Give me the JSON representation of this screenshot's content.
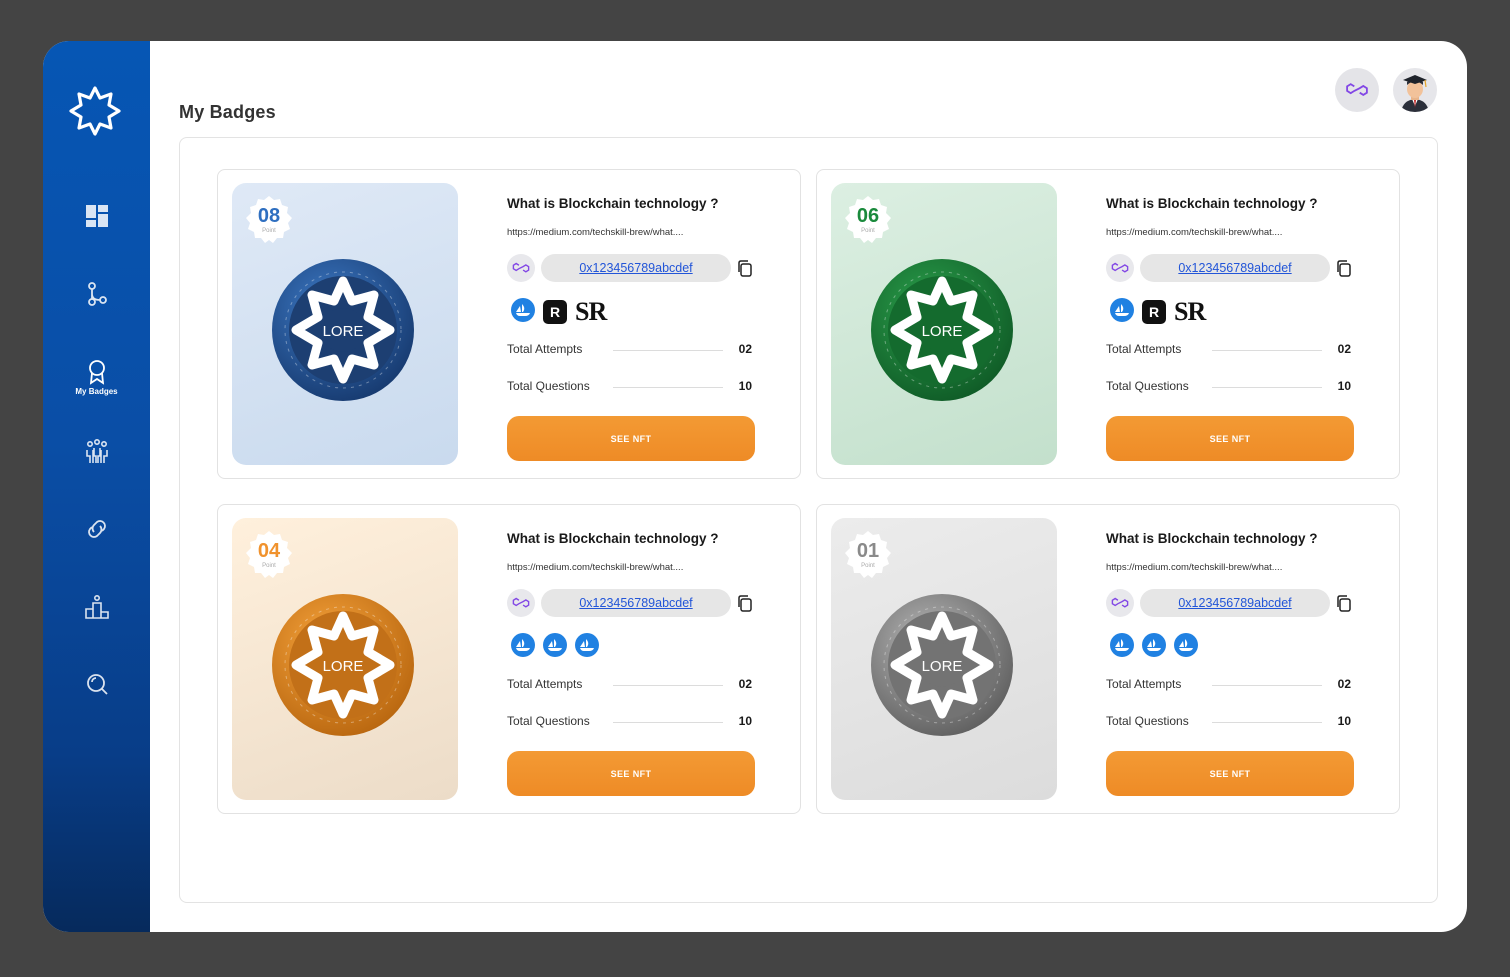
{
  "sidebar": {
    "items": [
      {
        "icon": "dashboard-icon",
        "label": ""
      },
      {
        "icon": "roadmap-icon",
        "label": ""
      },
      {
        "icon": "badge-icon",
        "label": "My Badges",
        "active": true
      },
      {
        "icon": "community-icon",
        "label": ""
      },
      {
        "icon": "link-icon",
        "label": ""
      },
      {
        "icon": "leaderboard-icon",
        "label": ""
      },
      {
        "icon": "search-icon",
        "label": ""
      }
    ]
  },
  "header": {
    "title": "My Badges",
    "chain_icon": "polygon-icon",
    "avatar_icon": "graduate-avatar-icon"
  },
  "badges": [
    {
      "points": "08",
      "points_label": "Point",
      "theme": "blue",
      "title": "What is Blockchain technology ?",
      "url": "https://medium.com/techskill-brew/what....",
      "address": "0x123456789abcdef",
      "platforms": [
        "opensea-icon",
        "rarible-icon",
        "SR"
      ],
      "attempts_label": "Total Attempts",
      "attempts": "02",
      "questions_label": "Total Questions",
      "questions": "10",
      "button": "SEE NFT",
      "coin_text": "LORE"
    },
    {
      "points": "06",
      "points_label": "Point",
      "theme": "green",
      "title": "What is Blockchain technology ?",
      "url": "https://medium.com/techskill-brew/what....",
      "address": "0x123456789abcdef",
      "platforms": [
        "opensea-icon",
        "rarible-icon",
        "SR"
      ],
      "attempts_label": "Total Attempts",
      "attempts": "02",
      "questions_label": "Total Questions",
      "questions": "10",
      "button": "SEE NFT",
      "coin_text": "LORE"
    },
    {
      "points": "04",
      "points_label": "Point",
      "theme": "orange",
      "title": "What is Blockchain technology ?",
      "url": "https://medium.com/techskill-brew/what....",
      "address": "0x123456789abcdef",
      "platforms": [
        "opensea-icon",
        "opensea-icon",
        "opensea-icon"
      ],
      "attempts_label": "Total Attempts",
      "attempts": "02",
      "questions_label": "Total Questions",
      "questions": "10",
      "button": "SEE NFT",
      "coin_text": "LORE"
    },
    {
      "points": "01",
      "points_label": "Point",
      "theme": "gray",
      "title": "What is Blockchain technology ?",
      "url": "https://medium.com/techskill-brew/what....",
      "address": "0x123456789abcdef",
      "platforms": [
        "opensea-icon",
        "opensea-icon",
        "opensea-icon"
      ],
      "attempts_label": "Total Attempts",
      "attempts": "02",
      "questions_label": "Total Questions",
      "questions": "10",
      "button": "SEE NFT",
      "coin_text": "LORE"
    }
  ],
  "colors": {
    "accent_orange": "#f0922d",
    "sidebar_blue": "#0656b4",
    "link_blue": "#2255d8",
    "polygon_purple": "#8247e5",
    "blue": "#2f6fc0",
    "green": "#1a8a3c",
    "orange": "#f0922d",
    "gray": "#9a9a9a"
  }
}
